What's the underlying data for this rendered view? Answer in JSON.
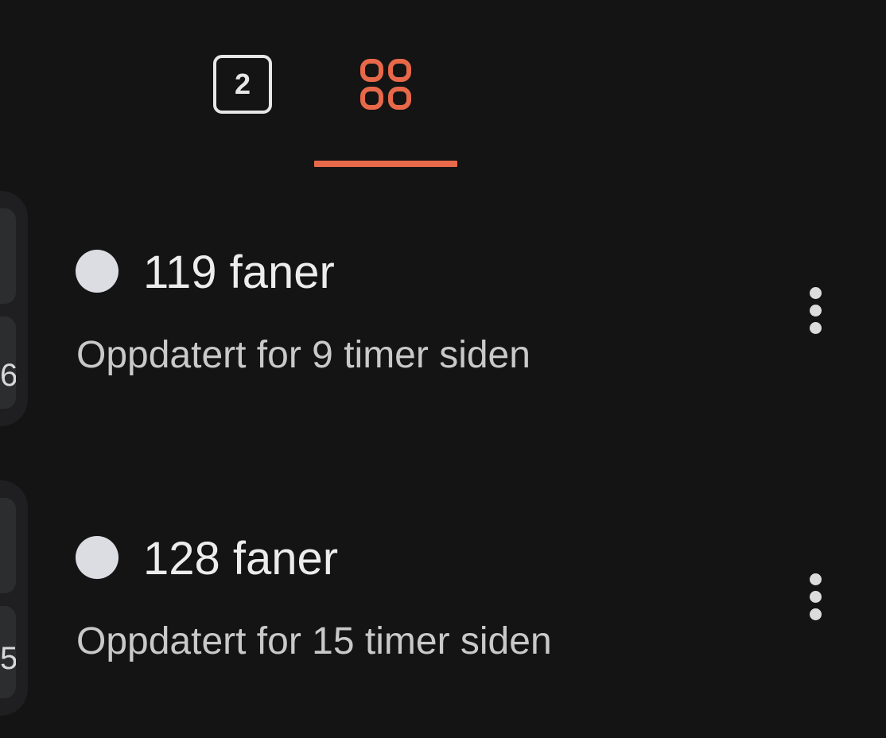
{
  "tabs": {
    "open_tabs_count": "2",
    "selected": "tab-groups"
  },
  "colors": {
    "accent": "#e8684a",
    "background": "#141414",
    "dot": "#dcdde2"
  },
  "groups": [
    {
      "title": "119 faner",
      "subtitle": "Oppdatert for 9 timer siden",
      "thumb_glyph": "6"
    },
    {
      "title": "128 faner",
      "subtitle": "Oppdatert for 15 timer siden",
      "thumb_glyph": "5"
    }
  ]
}
